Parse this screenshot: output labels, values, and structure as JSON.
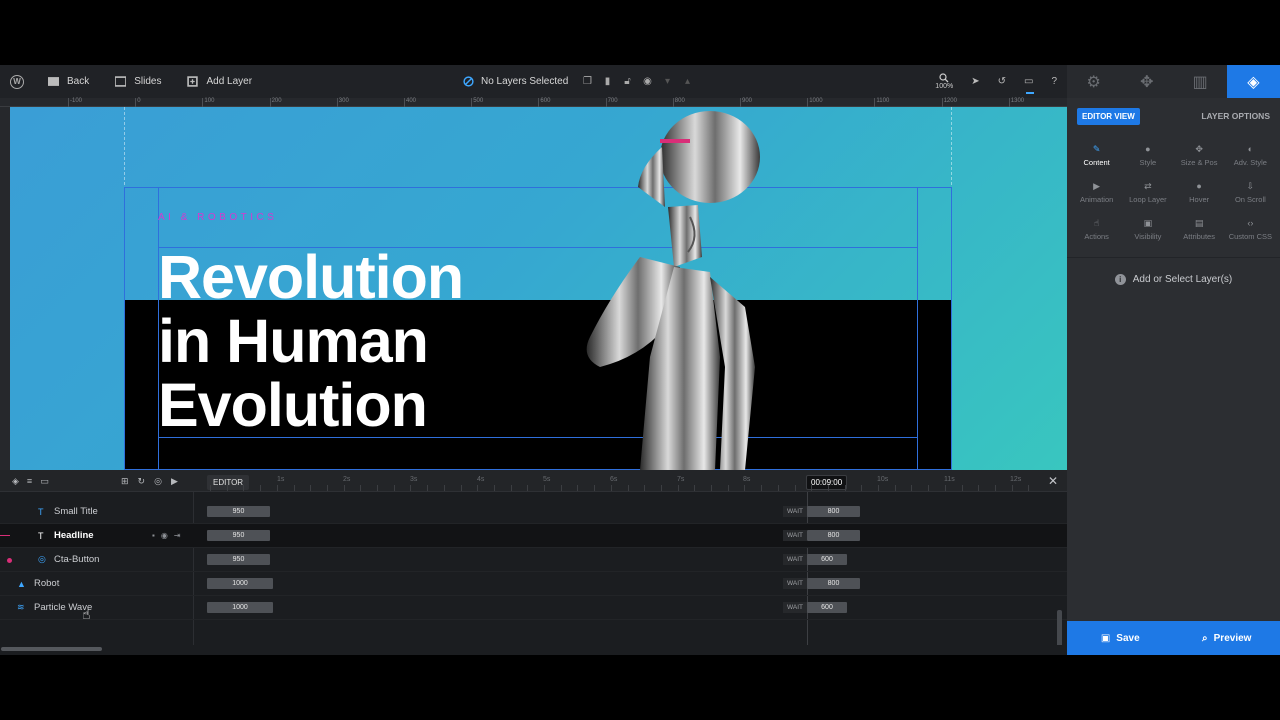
{
  "topbar": {
    "back_label": "Back",
    "slides_label": "Slides",
    "add_layer_label": "Add Layer",
    "selection_label": "No Layers Selected",
    "zoom_label": "100%"
  },
  "right_panel": {
    "editor_view_label": "EDITOR VIEW",
    "layer_options_label": "LAYER OPTIONS",
    "options": [
      {
        "label": "Content",
        "icon": "pencil-icon"
      },
      {
        "label": "Style",
        "icon": "palette-icon"
      },
      {
        "label": "Size & Pos",
        "icon": "move-icon"
      },
      {
        "label": "Adv. Style",
        "icon": "contrast-icon"
      },
      {
        "label": "Animation",
        "icon": "play-icon"
      },
      {
        "label": "Loop Layer",
        "icon": "loop-icon"
      },
      {
        "label": "Hover",
        "icon": "mouse-icon"
      },
      {
        "label": "On Scroll",
        "icon": "scroll-icon"
      },
      {
        "label": "Actions",
        "icon": "hand-icon"
      },
      {
        "label": "Visibility",
        "icon": "visibility-icon"
      },
      {
        "label": "Attributes",
        "icon": "file-icon"
      },
      {
        "label": "Custom CSS",
        "icon": "code-icon"
      }
    ],
    "empty_state": "Add or Select Layer(s)",
    "save_label": "Save",
    "preview_label": "Preview"
  },
  "ruler": {
    "labels": [
      "-100",
      "0",
      "100",
      "200",
      "300",
      "400",
      "500",
      "600",
      "700",
      "800",
      "900",
      "1000",
      "1100",
      "1200",
      "1300"
    ]
  },
  "canvas": {
    "small_title": "AI & ROBOTICS",
    "headline_lines": [
      "Revolution",
      "in Human",
      "Evolution"
    ],
    "accent_pink": "#d23bd0",
    "bg_blue": "#3a9ed6",
    "bg_teal": "#39c6bf"
  },
  "timeline": {
    "editor_label": "EDITOR",
    "seconds": [
      "1s",
      "2s",
      "3s",
      "4s",
      "5s",
      "6s",
      "7s",
      "8s",
      "10s",
      "11s",
      "12s"
    ],
    "current_time": "00:09:00",
    "rows": [
      {
        "name": "Small Title",
        "icon": "text-icon",
        "duration": "950",
        "wait_label": "WAIT",
        "wait_value": "800"
      },
      {
        "name": "Headline",
        "icon": "text-icon",
        "duration": "950",
        "wait_label": "WAIT",
        "wait_value": "800"
      },
      {
        "name": "Cta-Button",
        "icon": "button-icon",
        "duration": "950",
        "wait_label": "WAIT",
        "wait_value": "600"
      },
      {
        "name": "Robot",
        "icon": "image-icon",
        "duration": "1000",
        "wait_label": "WAIT",
        "wait_value": "800"
      },
      {
        "name": "Particle Wave",
        "icon": "wave-icon",
        "duration": "1000",
        "wait_label": "WAIT",
        "wait_value": "600"
      }
    ]
  }
}
